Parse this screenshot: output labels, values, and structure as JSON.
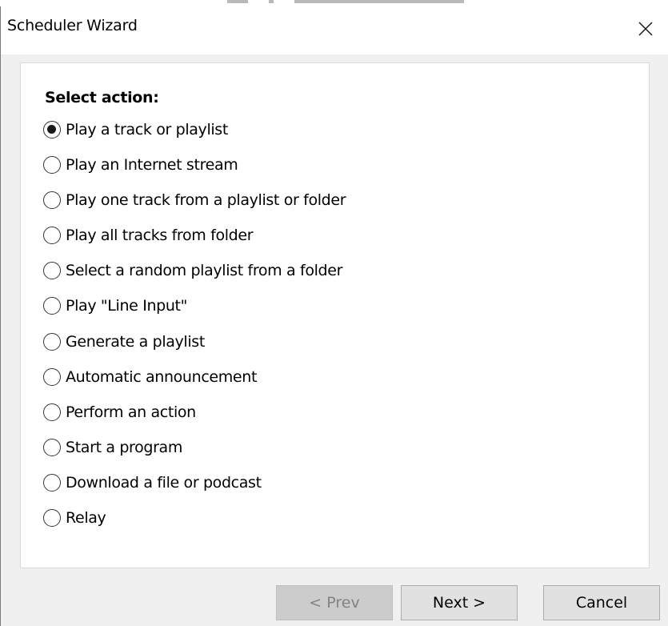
{
  "window": {
    "title": "Scheduler Wizard",
    "close_icon": "close-icon"
  },
  "panel": {
    "heading": "Select action:",
    "selected_index": 0,
    "options": [
      {
        "label": "Play a track or playlist",
        "checked": true
      },
      {
        "label": "Play an Internet stream",
        "checked": false
      },
      {
        "label": "Play one track from a playlist or folder",
        "checked": false
      },
      {
        "label": "Play all tracks from folder",
        "checked": false
      },
      {
        "label": "Select a random playlist from a folder",
        "checked": false
      },
      {
        "label": "Play \"Line Input\"",
        "checked": false
      },
      {
        "label": "Generate a playlist",
        "checked": false
      },
      {
        "label": "Automatic announcement",
        "checked": false
      },
      {
        "label": "Perform an action",
        "checked": false
      },
      {
        "label": "Start a program",
        "checked": false
      },
      {
        "label": "Download a file or podcast",
        "checked": false
      },
      {
        "label": "Relay",
        "checked": false
      }
    ]
  },
  "footer": {
    "prev_label": "< Prev",
    "prev_enabled": false,
    "next_label": "Next >",
    "cancel_label": "Cancel"
  }
}
